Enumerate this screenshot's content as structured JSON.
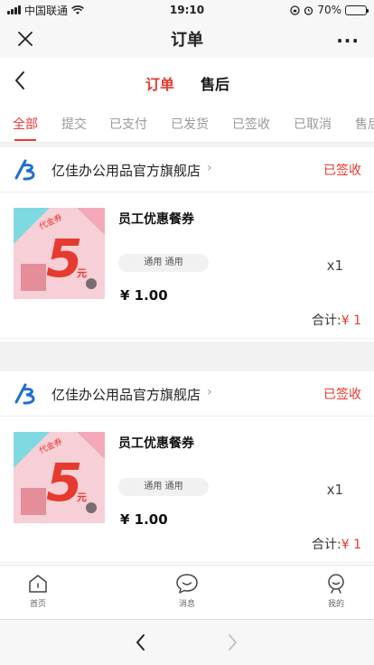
{
  "status_bar": {
    "carrier": "中国联通",
    "time": "19:10",
    "battery": "70%",
    "battery_level": 0.7
  },
  "app_bar": {
    "title": "订单"
  },
  "page_header": {
    "tabs": [
      {
        "label": "订单",
        "active": true
      },
      {
        "label": "售后",
        "active": false
      }
    ]
  },
  "status_tabs": [
    {
      "label": "全部",
      "active": true
    },
    {
      "label": "提交"
    },
    {
      "label": "已支付"
    },
    {
      "label": "已发货"
    },
    {
      "label": "已签收"
    },
    {
      "label": "已取消"
    },
    {
      "label": "售后"
    }
  ],
  "orders": [
    {
      "store_name": "亿佳办公用品官方旗舰店",
      "status": "已签收",
      "item": {
        "name": "员工优惠餐券",
        "spec": "通用 通用",
        "price": "¥ 1.00",
        "qty": "x1",
        "thumb_text": "代金券",
        "thumb_number": "5",
        "thumb_unit": "元"
      },
      "total_label": "合计:",
      "total_amount": "¥ 1"
    },
    {
      "store_name": "亿佳办公用品官方旗舰店",
      "status": "已签收",
      "item": {
        "name": "员工优惠餐券",
        "spec": "通用 通用",
        "price": "¥ 1.00",
        "qty": "x1",
        "thumb_text": "代金券",
        "thumb_number": "5",
        "thumb_unit": "元"
      },
      "total_label": "合计:",
      "total_amount": "¥ 1"
    }
  ],
  "tab_bar": [
    {
      "label": "首页",
      "icon": "home-icon"
    },
    {
      "label": "消息",
      "icon": "message-icon"
    },
    {
      "label": "我的",
      "icon": "profile-icon"
    }
  ],
  "colors": {
    "accent": "#e63a2e",
    "logo_blue": "#1f6fd1"
  }
}
